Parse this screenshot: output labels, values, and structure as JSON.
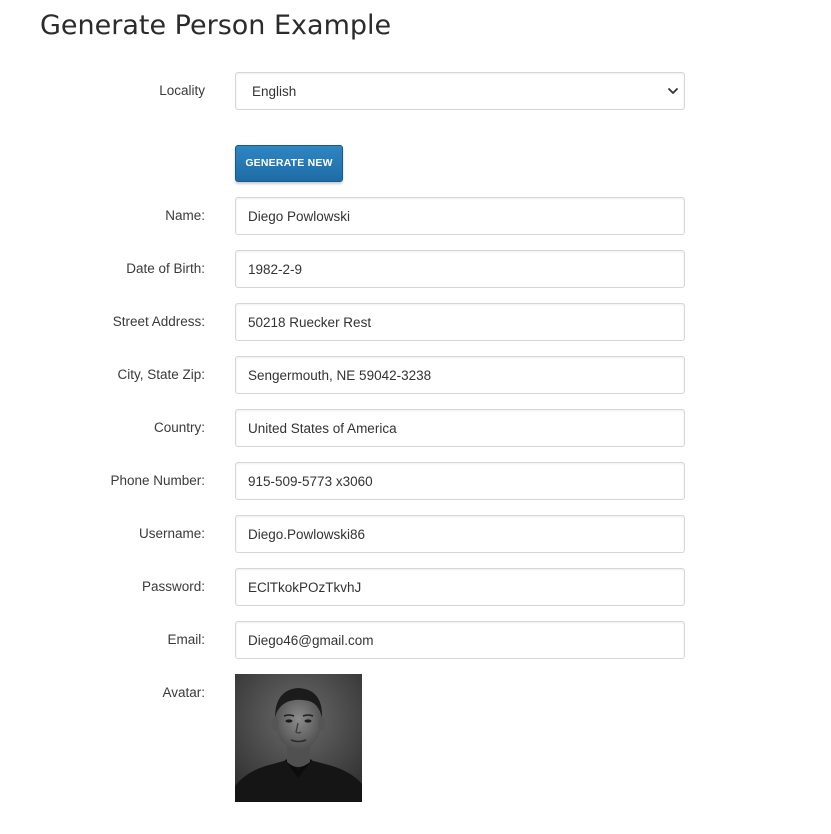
{
  "page": {
    "title": "Generate Person Example"
  },
  "form": {
    "locality": {
      "label": "Locality",
      "value": "English"
    },
    "generate_button": "GENERATE NEW",
    "fields": [
      {
        "label": "Name:",
        "value": "Diego Powlowski"
      },
      {
        "label": "Date of Birth:",
        "value": "1982-2-9"
      },
      {
        "label": "Street Address:",
        "value": "50218 Ruecker Rest"
      },
      {
        "label": "City, State Zip:",
        "value": "Sengermouth, NE 59042-3238"
      },
      {
        "label": "Country:",
        "value": "United States of America"
      },
      {
        "label": "Phone Number:",
        "value": "915-509-5773 x3060"
      },
      {
        "label": "Username:",
        "value": "Diego.Powlowski86"
      },
      {
        "label": "Password:",
        "value": "EClTkokPOzTkvhJ"
      },
      {
        "label": "Email:",
        "value": "Diego46@gmail.com"
      }
    ],
    "avatar": {
      "label": "Avatar:"
    }
  },
  "icons": {
    "locality_dropdown": "chevron-down-icon"
  },
  "colors": {
    "primary_button": "#2374b3",
    "text": "#333333",
    "input_border": "#d6d6d6"
  }
}
